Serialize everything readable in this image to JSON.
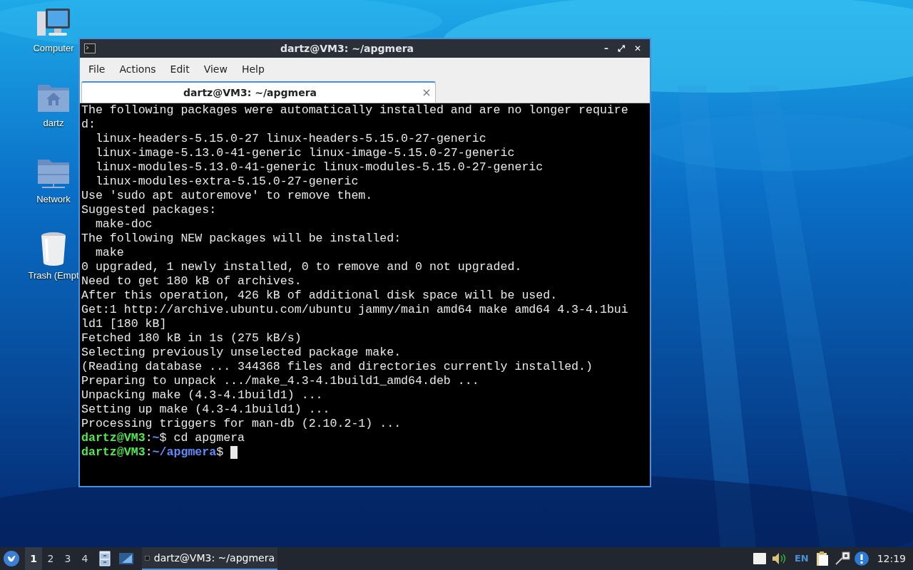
{
  "desktop_icons": [
    {
      "kind": "computer",
      "label": "Computer"
    },
    {
      "kind": "home",
      "label": "dartz"
    },
    {
      "kind": "network",
      "label": "Network"
    },
    {
      "kind": "trash",
      "label": "Trash (Empt"
    }
  ],
  "window": {
    "title": "dartz@VM3: ~/apgmera",
    "controls": [
      "–",
      "⤢",
      "✕"
    ]
  },
  "menu": [
    "File",
    "Actions",
    "Edit",
    "View",
    "Help"
  ],
  "tabs": [
    {
      "label": "dartz@VM3: ~/apgmera",
      "selected": true,
      "close": "×"
    }
  ],
  "terminal": {
    "lines": [
      [
        {
          "kind": "plain",
          "text": "The following packages were automatically installed and are no longer require"
        }
      ],
      [
        {
          "kind": "plain",
          "text": "d:"
        }
      ],
      [
        {
          "kind": "plain",
          "text": "  linux-headers-5.15.0-27 linux-headers-5.15.0-27-generic"
        }
      ],
      [
        {
          "kind": "plain",
          "text": "  linux-image-5.13.0-41-generic linux-image-5.15.0-27-generic"
        }
      ],
      [
        {
          "kind": "plain",
          "text": "  linux-modules-5.13.0-41-generic linux-modules-5.15.0-27-generic"
        }
      ],
      [
        {
          "kind": "plain",
          "text": "  linux-modules-extra-5.15.0-27-generic"
        }
      ],
      [
        {
          "kind": "plain",
          "text": "Use 'sudo apt autoremove' to remove them."
        }
      ],
      [
        {
          "kind": "plain",
          "text": "Suggested packages:"
        }
      ],
      [
        {
          "kind": "plain",
          "text": "  make-doc"
        }
      ],
      [
        {
          "kind": "plain",
          "text": "The following NEW packages will be installed:"
        }
      ],
      [
        {
          "kind": "plain",
          "text": "  make"
        }
      ],
      [
        {
          "kind": "plain",
          "text": "0 upgraded, 1 newly installed, 0 to remove and 0 not upgraded."
        }
      ],
      [
        {
          "kind": "plain",
          "text": "Need to get 180 kB of archives."
        }
      ],
      [
        {
          "kind": "plain",
          "text": "After this operation, 426 kB of additional disk space will be used."
        }
      ],
      [
        {
          "kind": "plain",
          "text": "Get:1 http://archive.ubuntu.com/ubuntu jammy/main amd64 make amd64 4.3-4.1bui"
        }
      ],
      [
        {
          "kind": "plain",
          "text": "ld1 [180 kB]"
        }
      ],
      [
        {
          "kind": "plain",
          "text": "Fetched 180 kB in 1s (275 kB/s)"
        }
      ],
      [
        {
          "kind": "plain",
          "text": "Selecting previously unselected package make."
        }
      ],
      [
        {
          "kind": "plain",
          "text": "(Reading database ... 344368 files and directories currently installed.)"
        }
      ],
      [
        {
          "kind": "plain",
          "text": "Preparing to unpack .../make_4.3-4.1build1_amd64.deb ..."
        }
      ],
      [
        {
          "kind": "plain",
          "text": "Unpacking make (4.3-4.1build1) ..."
        }
      ],
      [
        {
          "kind": "plain",
          "text": "Setting up make (4.3-4.1build1) ..."
        }
      ],
      [
        {
          "kind": "plain",
          "text": "Processing triggers for man-db (2.10.2-1) ..."
        }
      ],
      [
        {
          "kind": "user",
          "text": "dartz@VM3"
        },
        {
          "kind": "plain",
          "text": ":"
        },
        {
          "kind": "path",
          "text": "~"
        },
        {
          "kind": "plain",
          "text": "$ cd apgmera"
        }
      ],
      [
        {
          "kind": "user",
          "text": "dartz@VM3"
        },
        {
          "kind": "plain",
          "text": ":"
        },
        {
          "kind": "path",
          "text": "~/apgmera"
        },
        {
          "kind": "plain",
          "text": "$ "
        },
        {
          "kind": "cursor"
        }
      ]
    ]
  },
  "taskbar": {
    "workspaces": [
      {
        "label": "1",
        "selected": true
      },
      {
        "label": "2",
        "selected": false
      },
      {
        "label": "3",
        "selected": false
      },
      {
        "label": "4",
        "selected": false
      }
    ],
    "tasks": [
      {
        "label": "dartz@VM3: ~/apgmera",
        "selected": true
      }
    ],
    "keyboard_layout": "EN",
    "clock": "12:19"
  }
}
